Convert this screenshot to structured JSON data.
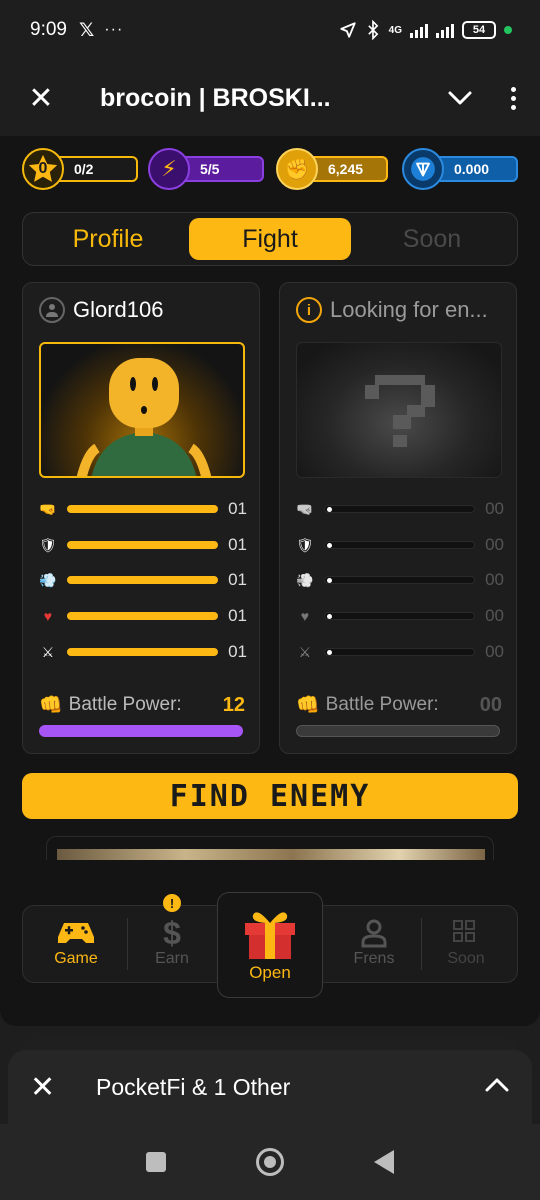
{
  "status_bar": {
    "time": "9:09",
    "network": "4G",
    "battery": "54"
  },
  "header": {
    "title": "brocoin | BROSKI..."
  },
  "resources": {
    "level": "0",
    "stars": "0/2",
    "energy": "5/5",
    "coins": "6,245",
    "ton": "0.000"
  },
  "tabs": [
    {
      "label": "Profile"
    },
    {
      "label": "Fight"
    },
    {
      "label": "Soon"
    }
  ],
  "player": {
    "name": "Glord106",
    "stats": [
      {
        "icon": "punch-icon",
        "value": "01",
        "level": 1
      },
      {
        "icon": "shield-icon",
        "value": "01",
        "level": 1
      },
      {
        "icon": "dodge-icon",
        "value": "01",
        "level": 1
      },
      {
        "icon": "heart-icon",
        "value": "01",
        "level": 1
      },
      {
        "icon": "swords-icon",
        "value": "01",
        "level": 1
      }
    ],
    "battle_power_label": "Battle Power:",
    "battle_power": "12"
  },
  "enemy": {
    "name": "Looking for en...",
    "stats": [
      {
        "icon": "punch-icon",
        "value": "00",
        "level": 0
      },
      {
        "icon": "shield-icon",
        "value": "00",
        "level": 0
      },
      {
        "icon": "dodge-icon",
        "value": "00",
        "level": 0
      },
      {
        "icon": "heart-icon",
        "value": "00",
        "level": 0
      },
      {
        "icon": "swords-icon",
        "value": "00",
        "level": 0
      }
    ],
    "battle_power_label": "Battle Power:",
    "battle_power": "00"
  },
  "find_enemy_label": "FIND ENEMY",
  "bottom_nav": {
    "game": "Game",
    "earn": "Earn",
    "open": "Open",
    "frens": "Frens",
    "soon": "Soon",
    "earn_badge": "!"
  },
  "sheet": {
    "title": "PocketFi & 1 Other"
  },
  "colors": {
    "accent": "#fdb814",
    "energy": "#7c22ce",
    "ton": "#1d7fd6",
    "battle_bar": "#a855f7"
  }
}
